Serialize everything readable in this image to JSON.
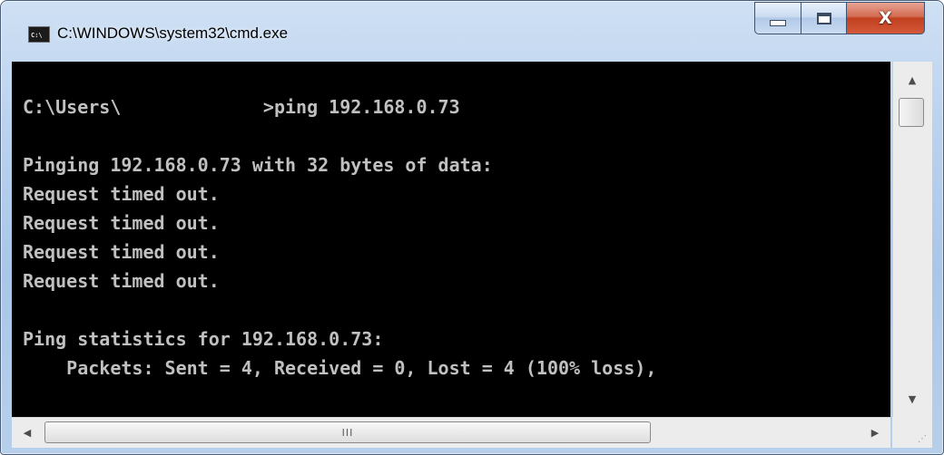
{
  "window": {
    "title": "C:\\WINDOWS\\system32\\cmd.exe",
    "icon_name": "cmd-app-icon",
    "icon_glyph": "C:\\"
  },
  "caption_buttons": {
    "minimize_icon": "minimize-icon",
    "maximize_icon": "maximize-icon",
    "close_glyph": "X"
  },
  "console": {
    "lines": [
      "",
      "C:\\Users\\             >ping 192.168.0.73",
      "",
      "Pinging 192.168.0.73 with 32 bytes of data:",
      "Request timed out.",
      "Request timed out.",
      "Request timed out.",
      "Request timed out.",
      "",
      "Ping statistics for 192.168.0.73:",
      "    Packets: Sent = 4, Received = 0, Lost = 4 (100% loss),"
    ],
    "text_color": "#c0c0c0",
    "background": "#000000"
  },
  "scrollbars": {
    "up_arrow": "▲",
    "down_arrow": "▼",
    "left_arrow": "◀",
    "right_arrow": "▶",
    "thumb_grip": "III"
  }
}
